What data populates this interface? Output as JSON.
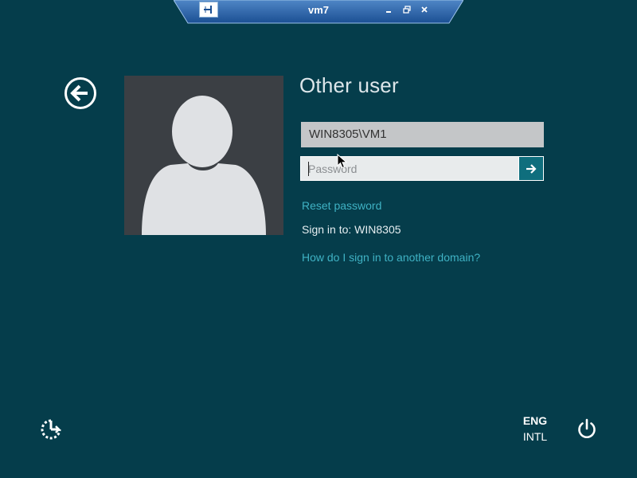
{
  "connection_bar": {
    "title": "vm7",
    "pin_icon": "pin-icon",
    "controls": [
      "minimize-icon",
      "restore-icon",
      "close-icon"
    ]
  },
  "login": {
    "heading": "Other user",
    "username_value": "WIN8305\\VM1",
    "password_placeholder": "Password",
    "reset_password_link": "Reset password",
    "sign_in_to": "Sign in to: WIN8305",
    "domain_help_link": "How do I sign in to another domain?"
  },
  "bottom": {
    "language_code": "ENG",
    "keyboard_layout": "INTL",
    "ease_of_access_icon": "ease-of-access-icon",
    "power_icon": "power-icon"
  },
  "colors": {
    "background": "#053d4b",
    "accent_link": "#3fb2c4",
    "submit_button": "#0f6e7d",
    "avatar_bg": "#3b3f44"
  }
}
